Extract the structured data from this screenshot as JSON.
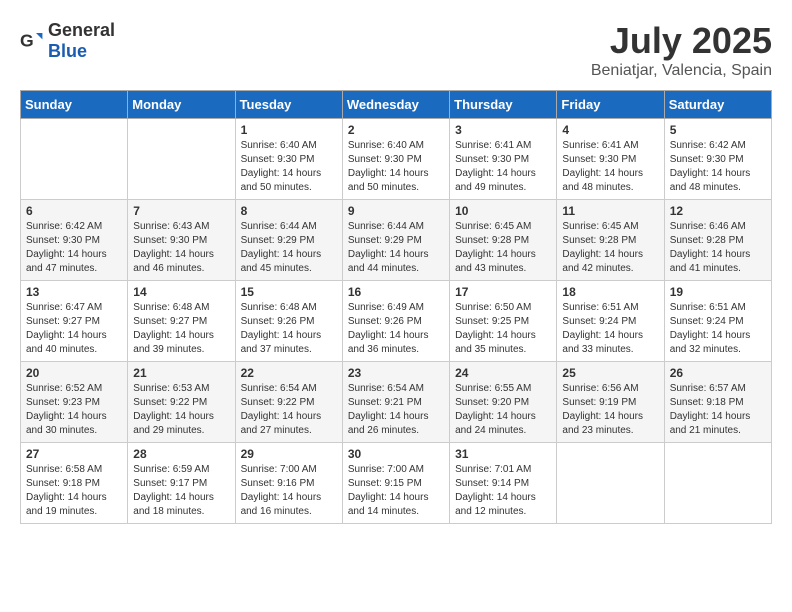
{
  "header": {
    "logo_general": "General",
    "logo_blue": "Blue",
    "month_year": "July 2025",
    "location": "Beniatjar, Valencia, Spain"
  },
  "weekdays": [
    "Sunday",
    "Monday",
    "Tuesday",
    "Wednesday",
    "Thursday",
    "Friday",
    "Saturday"
  ],
  "weeks": [
    [
      {
        "day": "",
        "sunrise": "",
        "sunset": "",
        "daylight": ""
      },
      {
        "day": "",
        "sunrise": "",
        "sunset": "",
        "daylight": ""
      },
      {
        "day": "1",
        "sunrise": "Sunrise: 6:40 AM",
        "sunset": "Sunset: 9:30 PM",
        "daylight": "Daylight: 14 hours and 50 minutes."
      },
      {
        "day": "2",
        "sunrise": "Sunrise: 6:40 AM",
        "sunset": "Sunset: 9:30 PM",
        "daylight": "Daylight: 14 hours and 50 minutes."
      },
      {
        "day": "3",
        "sunrise": "Sunrise: 6:41 AM",
        "sunset": "Sunset: 9:30 PM",
        "daylight": "Daylight: 14 hours and 49 minutes."
      },
      {
        "day": "4",
        "sunrise": "Sunrise: 6:41 AM",
        "sunset": "Sunset: 9:30 PM",
        "daylight": "Daylight: 14 hours and 48 minutes."
      },
      {
        "day": "5",
        "sunrise": "Sunrise: 6:42 AM",
        "sunset": "Sunset: 9:30 PM",
        "daylight": "Daylight: 14 hours and 48 minutes."
      }
    ],
    [
      {
        "day": "6",
        "sunrise": "Sunrise: 6:42 AM",
        "sunset": "Sunset: 9:30 PM",
        "daylight": "Daylight: 14 hours and 47 minutes."
      },
      {
        "day": "7",
        "sunrise": "Sunrise: 6:43 AM",
        "sunset": "Sunset: 9:30 PM",
        "daylight": "Daylight: 14 hours and 46 minutes."
      },
      {
        "day": "8",
        "sunrise": "Sunrise: 6:44 AM",
        "sunset": "Sunset: 9:29 PM",
        "daylight": "Daylight: 14 hours and 45 minutes."
      },
      {
        "day": "9",
        "sunrise": "Sunrise: 6:44 AM",
        "sunset": "Sunset: 9:29 PM",
        "daylight": "Daylight: 14 hours and 44 minutes."
      },
      {
        "day": "10",
        "sunrise": "Sunrise: 6:45 AM",
        "sunset": "Sunset: 9:28 PM",
        "daylight": "Daylight: 14 hours and 43 minutes."
      },
      {
        "day": "11",
        "sunrise": "Sunrise: 6:45 AM",
        "sunset": "Sunset: 9:28 PM",
        "daylight": "Daylight: 14 hours and 42 minutes."
      },
      {
        "day": "12",
        "sunrise": "Sunrise: 6:46 AM",
        "sunset": "Sunset: 9:28 PM",
        "daylight": "Daylight: 14 hours and 41 minutes."
      }
    ],
    [
      {
        "day": "13",
        "sunrise": "Sunrise: 6:47 AM",
        "sunset": "Sunset: 9:27 PM",
        "daylight": "Daylight: 14 hours and 40 minutes."
      },
      {
        "day": "14",
        "sunrise": "Sunrise: 6:48 AM",
        "sunset": "Sunset: 9:27 PM",
        "daylight": "Daylight: 14 hours and 39 minutes."
      },
      {
        "day": "15",
        "sunrise": "Sunrise: 6:48 AM",
        "sunset": "Sunset: 9:26 PM",
        "daylight": "Daylight: 14 hours and 37 minutes."
      },
      {
        "day": "16",
        "sunrise": "Sunrise: 6:49 AM",
        "sunset": "Sunset: 9:26 PM",
        "daylight": "Daylight: 14 hours and 36 minutes."
      },
      {
        "day": "17",
        "sunrise": "Sunrise: 6:50 AM",
        "sunset": "Sunset: 9:25 PM",
        "daylight": "Daylight: 14 hours and 35 minutes."
      },
      {
        "day": "18",
        "sunrise": "Sunrise: 6:51 AM",
        "sunset": "Sunset: 9:24 PM",
        "daylight": "Daylight: 14 hours and 33 minutes."
      },
      {
        "day": "19",
        "sunrise": "Sunrise: 6:51 AM",
        "sunset": "Sunset: 9:24 PM",
        "daylight": "Daylight: 14 hours and 32 minutes."
      }
    ],
    [
      {
        "day": "20",
        "sunrise": "Sunrise: 6:52 AM",
        "sunset": "Sunset: 9:23 PM",
        "daylight": "Daylight: 14 hours and 30 minutes."
      },
      {
        "day": "21",
        "sunrise": "Sunrise: 6:53 AM",
        "sunset": "Sunset: 9:22 PM",
        "daylight": "Daylight: 14 hours and 29 minutes."
      },
      {
        "day": "22",
        "sunrise": "Sunrise: 6:54 AM",
        "sunset": "Sunset: 9:22 PM",
        "daylight": "Daylight: 14 hours and 27 minutes."
      },
      {
        "day": "23",
        "sunrise": "Sunrise: 6:54 AM",
        "sunset": "Sunset: 9:21 PM",
        "daylight": "Daylight: 14 hours and 26 minutes."
      },
      {
        "day": "24",
        "sunrise": "Sunrise: 6:55 AM",
        "sunset": "Sunset: 9:20 PM",
        "daylight": "Daylight: 14 hours and 24 minutes."
      },
      {
        "day": "25",
        "sunrise": "Sunrise: 6:56 AM",
        "sunset": "Sunset: 9:19 PM",
        "daylight": "Daylight: 14 hours and 23 minutes."
      },
      {
        "day": "26",
        "sunrise": "Sunrise: 6:57 AM",
        "sunset": "Sunset: 9:18 PM",
        "daylight": "Daylight: 14 hours and 21 minutes."
      }
    ],
    [
      {
        "day": "27",
        "sunrise": "Sunrise: 6:58 AM",
        "sunset": "Sunset: 9:18 PM",
        "daylight": "Daylight: 14 hours and 19 minutes."
      },
      {
        "day": "28",
        "sunrise": "Sunrise: 6:59 AM",
        "sunset": "Sunset: 9:17 PM",
        "daylight": "Daylight: 14 hours and 18 minutes."
      },
      {
        "day": "29",
        "sunrise": "Sunrise: 7:00 AM",
        "sunset": "Sunset: 9:16 PM",
        "daylight": "Daylight: 14 hours and 16 minutes."
      },
      {
        "day": "30",
        "sunrise": "Sunrise: 7:00 AM",
        "sunset": "Sunset: 9:15 PM",
        "daylight": "Daylight: 14 hours and 14 minutes."
      },
      {
        "day": "31",
        "sunrise": "Sunrise: 7:01 AM",
        "sunset": "Sunset: 9:14 PM",
        "daylight": "Daylight: 14 hours and 12 minutes."
      },
      {
        "day": "",
        "sunrise": "",
        "sunset": "",
        "daylight": ""
      },
      {
        "day": "",
        "sunrise": "",
        "sunset": "",
        "daylight": ""
      }
    ]
  ]
}
